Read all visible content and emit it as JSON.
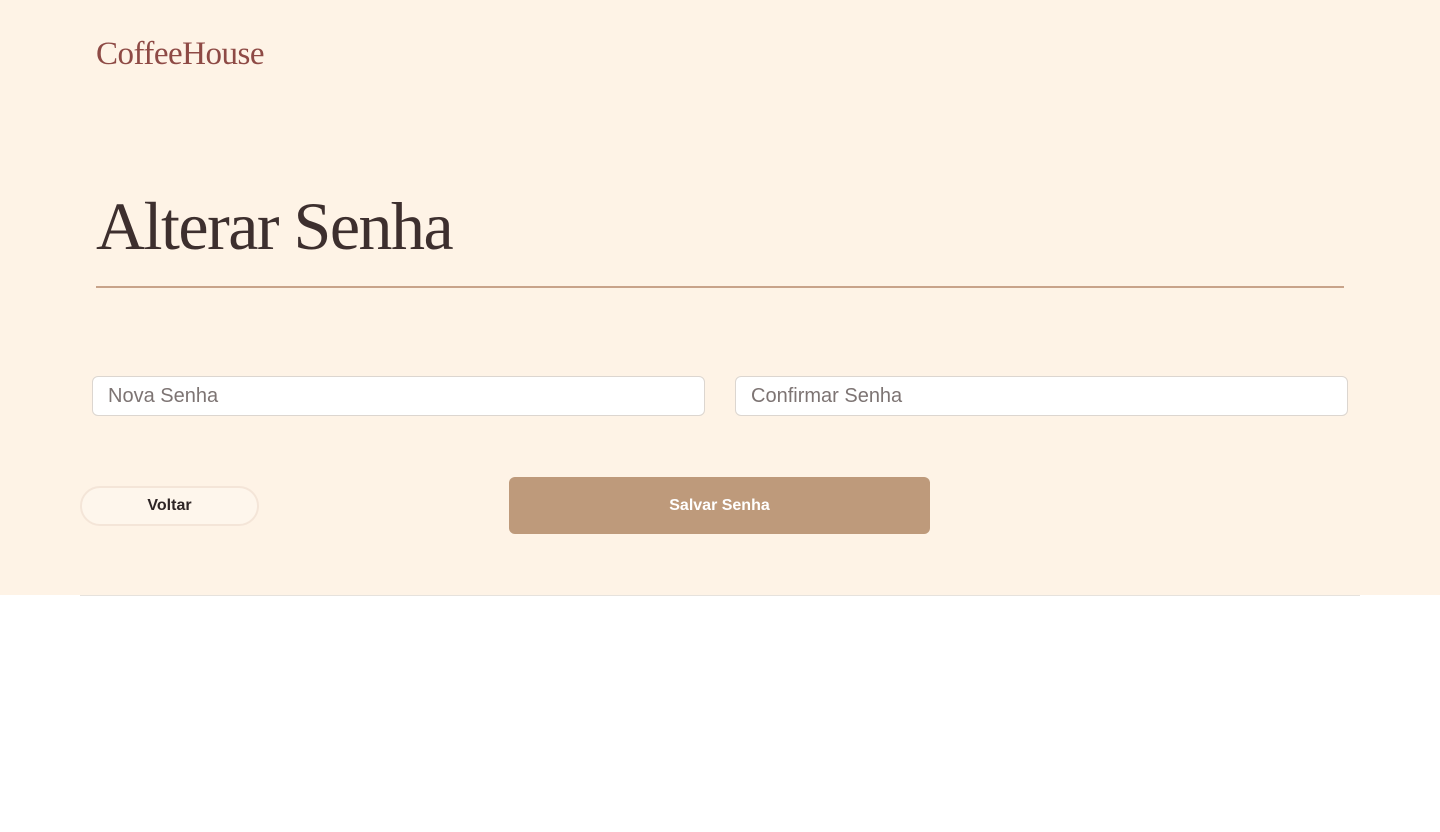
{
  "header": {
    "brand": "CoffeeHouse"
  },
  "main": {
    "title": "Alterar Senha",
    "fields": {
      "new_password": {
        "value": "",
        "placeholder": "Nova Senha"
      },
      "confirm_password": {
        "value": "",
        "placeholder": "Confirmar Senha"
      }
    },
    "buttons": {
      "back_label": "Voltar",
      "save_label": "Salvar Senha"
    }
  },
  "colors": {
    "background": "#fef3e6",
    "brand": "#8e4a45",
    "title": "#3d2f2e",
    "accent_rule": "#c8a38a",
    "primary_button": "#be9a7b"
  }
}
